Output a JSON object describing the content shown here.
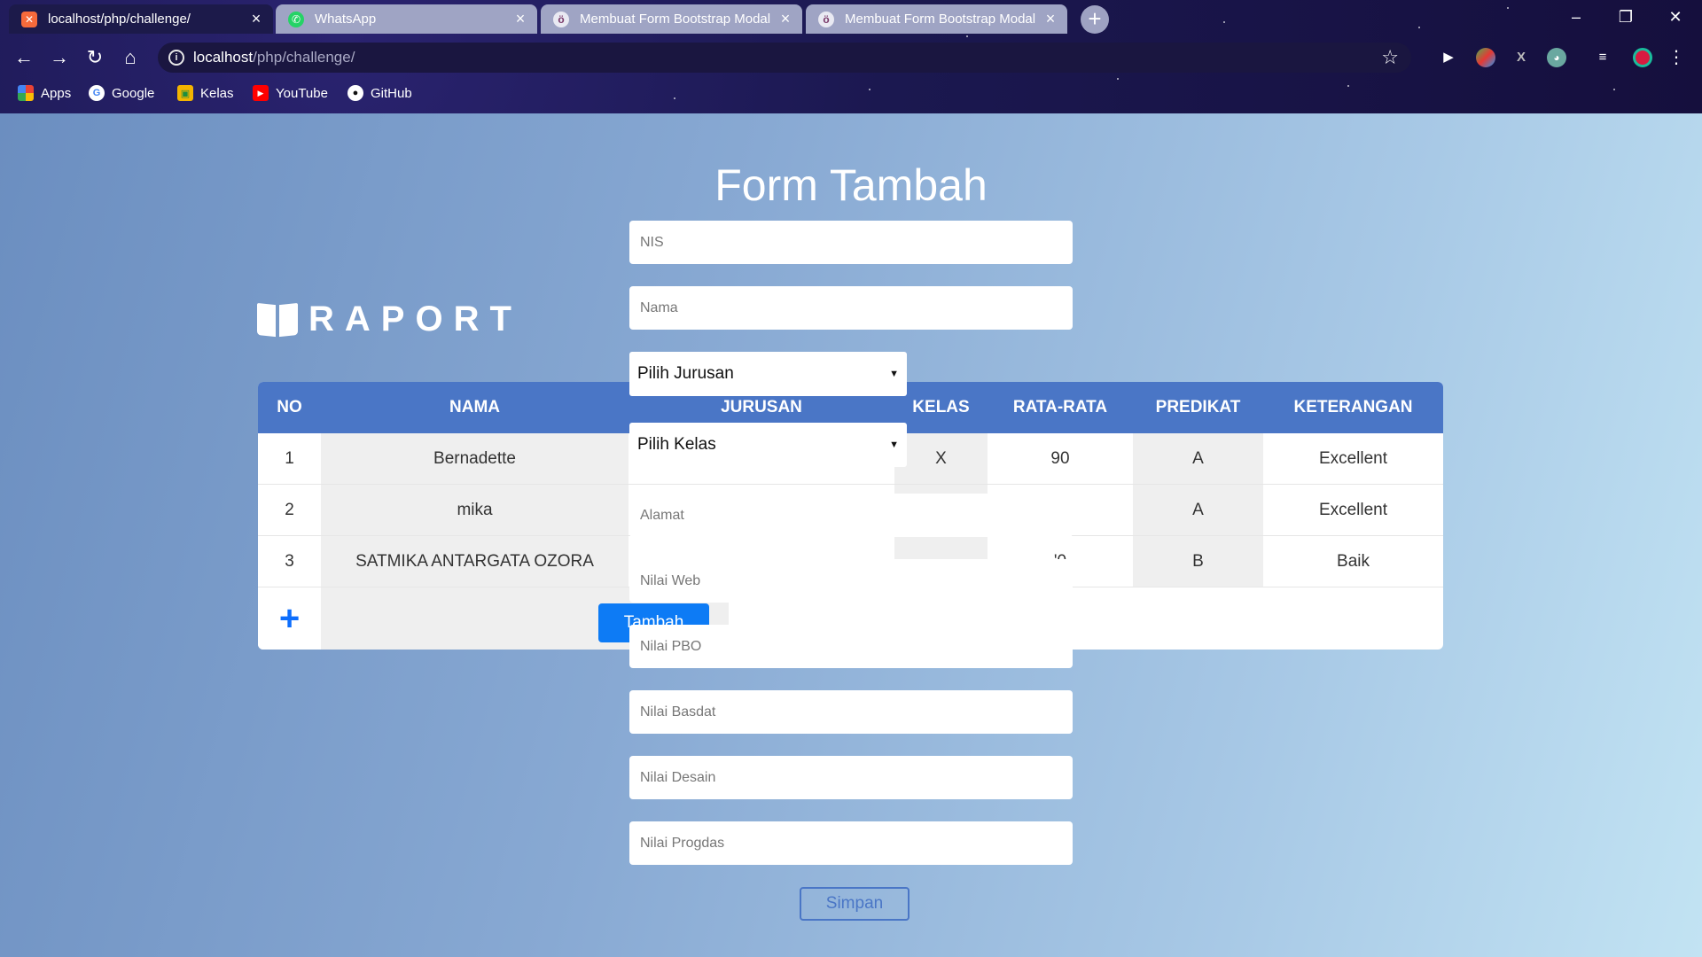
{
  "browser": {
    "tabs": [
      {
        "title": "localhost/php/challenge/",
        "active": true
      },
      {
        "title": "WhatsApp",
        "active": false
      },
      {
        "title": "Membuat Form Bootstrap Modal",
        "active": false
      },
      {
        "title": "Membuat Form Bootstrap Modal",
        "active": false
      }
    ],
    "url_host": "localhost",
    "url_path": "/php/challenge/",
    "bookmarks": [
      "Apps",
      "Google",
      "Kelas",
      "YouTube",
      "GitHub"
    ],
    "colors": {
      "accent": "#4a76c6",
      "button": "#0d7bf5"
    }
  },
  "brand": "RAPORT",
  "table": {
    "headers": [
      "NO",
      "NAMA",
      "JURUSAN",
      "KELAS",
      "RATA-RATA",
      "PREDIKAT",
      "KETERANGAN"
    ],
    "rows": [
      {
        "no": "1",
        "nama": "Bernadette",
        "kelas": "X",
        "rata": "90",
        "predikat": "A",
        "keterangan": "Excellent"
      },
      {
        "no": "2",
        "nama": "mika",
        "kelas": "",
        "rata": ")",
        "predikat": "A",
        "keterangan": "Excellent"
      },
      {
        "no": "3",
        "nama": "SATMIKA ANTARGATA OZORA",
        "kelas": "",
        "rata": "'0",
        "predikat": "B",
        "keterangan": "Baik"
      }
    ],
    "add_icon": "plus-icon",
    "tambah_label": "Tambah"
  },
  "form": {
    "title": "Form Tambah",
    "nis_placeholder": "NIS",
    "nama_placeholder": "Nama",
    "jurusan_select": "Pilih Jurusan",
    "kelas_select": "Pilih Kelas",
    "alamat_placeholder": "Alamat",
    "web_placeholder": "Nilai Web",
    "pbo_placeholder": "Nilai PBO",
    "basdat_placeholder": "Nilai Basdat",
    "desain_placeholder": "Nilai Desain",
    "progdas_placeholder": "Nilai Progdas",
    "submit_label": "Simpan"
  }
}
